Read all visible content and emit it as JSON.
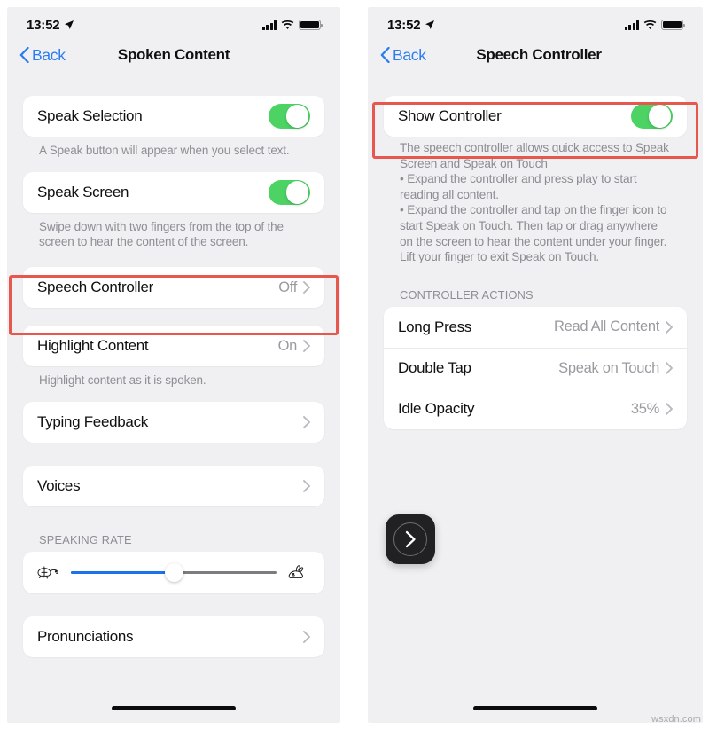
{
  "watermark": "wsxdn.com",
  "status_bar": {
    "time": "13:52",
    "location_icon": "location-arrow-icon",
    "signal_icon": "cellular-signal-icon",
    "wifi_icon": "wifi-icon",
    "battery_icon": "battery-full-icon"
  },
  "colors": {
    "toggle_on": "#4cd364",
    "accent_blue": "#2b7cf0",
    "slider_fill": "#1a72e8",
    "highlight_red": "#e8574d",
    "page_bg": "#f0f0f3",
    "card_bg": "#ffffff"
  },
  "left_screen": {
    "back_label": "Back",
    "title": "Spoken Content",
    "speak_selection": {
      "label": "Speak Selection",
      "toggle_state": "on",
      "footnote": "A Speak button will appear when you select text."
    },
    "speak_screen": {
      "label": "Speak Screen",
      "toggle_state": "on",
      "footnote": "Swipe down with two fingers from the top of the screen to hear the content of the screen."
    },
    "speech_controller": {
      "label": "Speech Controller",
      "value": "Off"
    },
    "highlight_content": {
      "label": "Highlight Content",
      "value": "On",
      "footnote": "Highlight content as it is spoken."
    },
    "typing_feedback": {
      "label": "Typing Feedback"
    },
    "voices": {
      "label": "Voices"
    },
    "speaking_rate": {
      "section_label": "SPEAKING RATE",
      "slow_icon": "turtle-icon",
      "fast_icon": "rabbit-icon",
      "value_percent": 50
    },
    "pronunciations": {
      "label": "Pronunciations"
    }
  },
  "right_screen": {
    "back_label": "Back",
    "title": "Speech Controller",
    "show_controller": {
      "label": "Show Controller",
      "toggle_state": "on"
    },
    "description": "The speech controller allows quick access to Speak Screen and Speak on Touch\n  • Expand the controller and press play to start reading all content.\n  • Expand the controller and tap on the finger icon to start Speak on Touch. Then tap or drag anywhere on the screen to hear the content under your finger. Lift your finger to exit Speak on Touch.",
    "controller_actions": {
      "section_label": "CONTROLLER ACTIONS",
      "rows": [
        {
          "label": "Long Press",
          "value": "Read All Content"
        },
        {
          "label": "Double Tap",
          "value": "Speak on Touch"
        },
        {
          "label": "Idle Opacity",
          "value": "35%"
        }
      ]
    },
    "floating_controller": {
      "icon": "chevron-right-in-circle-icon"
    }
  }
}
